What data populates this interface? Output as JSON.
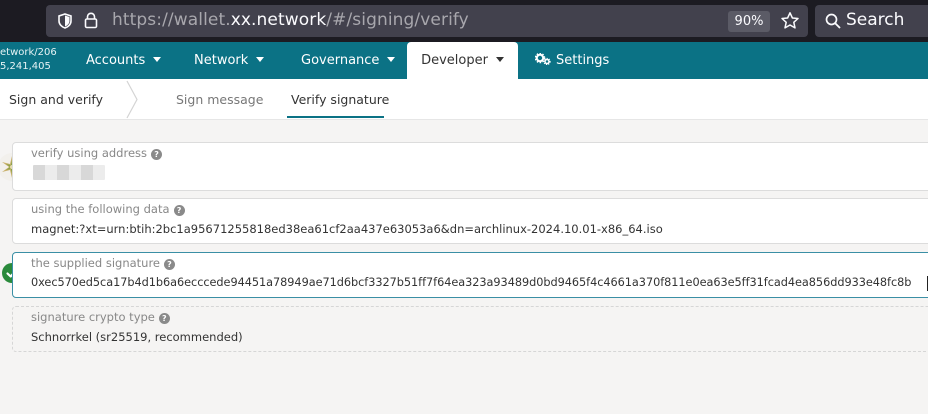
{
  "browser": {
    "url_prefix": "https://wallet.",
    "url_host": "xx.network",
    "url_path": "/#/signing/verify",
    "zoom": "90%",
    "search_label": "Search"
  },
  "chain": {
    "name": "etwork/206",
    "block": "5,241,405"
  },
  "nav": {
    "items": [
      {
        "label": "Accounts"
      },
      {
        "label": "Network"
      },
      {
        "label": "Governance"
      },
      {
        "label": "Developer"
      },
      {
        "label": "Settings"
      }
    ]
  },
  "subnav": {
    "title": "Sign and verify",
    "tabs": [
      {
        "label": "Sign message"
      },
      {
        "label": "Verify signature"
      }
    ]
  },
  "form": {
    "address": {
      "label": "verify using address",
      "help": "?"
    },
    "data": {
      "label": "using the following data",
      "help": "?",
      "value": "magnet:?xt=urn:btih:2bc1a95671255818ed38ea61cf2aa437e63053a6&dn=archlinux-2024.10.01-x86_64.iso"
    },
    "signature": {
      "label": "the supplied signature",
      "help": "?",
      "value": "0xec570ed5ca17b4d1b6a6ecccede94451a78949ae71d6bcf3327b51ff7f64ea323a93489d0bd9465f4c4661a370f811e0ea63e5ff31fcad4ea856dd933e48fc8b"
    },
    "crypto": {
      "label": "signature crypto type",
      "help": "?",
      "value": "Schnorrkel (sr25519, recommended)"
    }
  },
  "colors": {
    "nav_bg": "#0b7285",
    "verified": "#2a8a3b"
  }
}
